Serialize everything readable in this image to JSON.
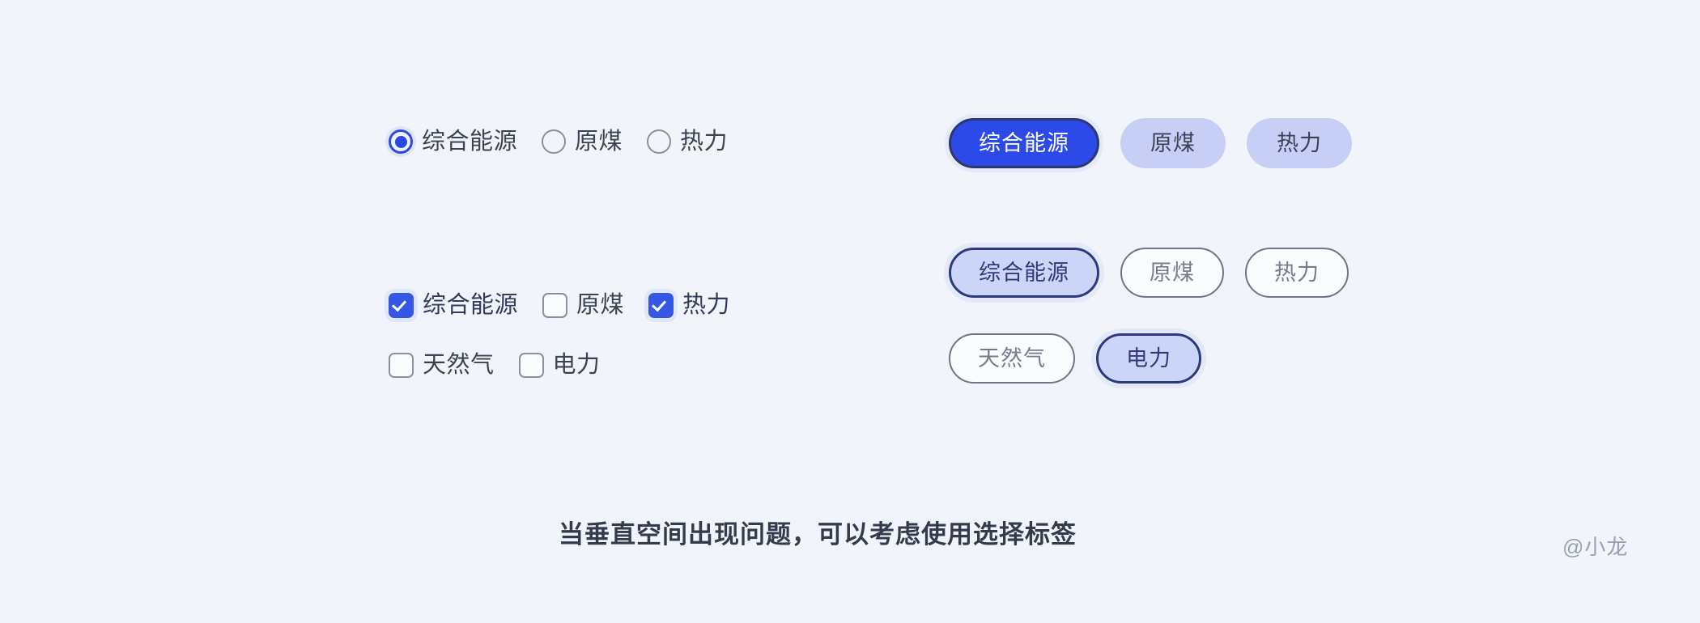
{
  "page": {
    "background_color": "#f1f4fa",
    "caption": "当垂直空间出现问题，可以考虑使用选择标签",
    "watermark": "@小龙"
  },
  "colors": {
    "primary_blue": "#2b4ae8",
    "checkbox_blue": "#3656e4",
    "tint_lavender": "#c7cff6",
    "tint_lavender_active": "#ccd4f8",
    "outline_navy": "#2c3880",
    "outline_gray": "#6e7585",
    "label_text": "#3b4252",
    "muted_text": "#767c8c",
    "watermark_text": "#9aa1b4"
  },
  "radio_group": {
    "name": "energy-type-radio",
    "options": [
      {
        "label": "综合能源",
        "selected": true
      },
      {
        "label": "原煤",
        "selected": false
      },
      {
        "label": "热力",
        "selected": false
      }
    ]
  },
  "checkbox_group": {
    "name": "energy-type-checkbox",
    "rows": [
      [
        {
          "label": "综合能源",
          "checked": true
        },
        {
          "label": "原煤",
          "checked": false
        },
        {
          "label": "热力",
          "checked": true
        }
      ],
      [
        {
          "label": "天然气",
          "checked": false
        },
        {
          "label": "电力",
          "checked": false
        }
      ]
    ]
  },
  "pill_single_select": {
    "name": "energy-type-pill-single",
    "options": [
      {
        "label": "综合能源",
        "selected": true,
        "style": "solid"
      },
      {
        "label": "原煤",
        "selected": false,
        "style": "tinted"
      },
      {
        "label": "热力",
        "selected": false,
        "style": "tinted"
      }
    ]
  },
  "pill_multi_select": {
    "name": "energy-type-pill-multi",
    "rows": [
      [
        {
          "label": "综合能源",
          "selected": true,
          "style": "outlined-active"
        },
        {
          "label": "原煤",
          "selected": false,
          "style": "outlined"
        },
        {
          "label": "热力",
          "selected": false,
          "style": "outlined"
        }
      ],
      [
        {
          "label": "天然气",
          "selected": false,
          "style": "outlined"
        },
        {
          "label": "电力",
          "selected": true,
          "style": "outlined-active"
        }
      ]
    ]
  }
}
